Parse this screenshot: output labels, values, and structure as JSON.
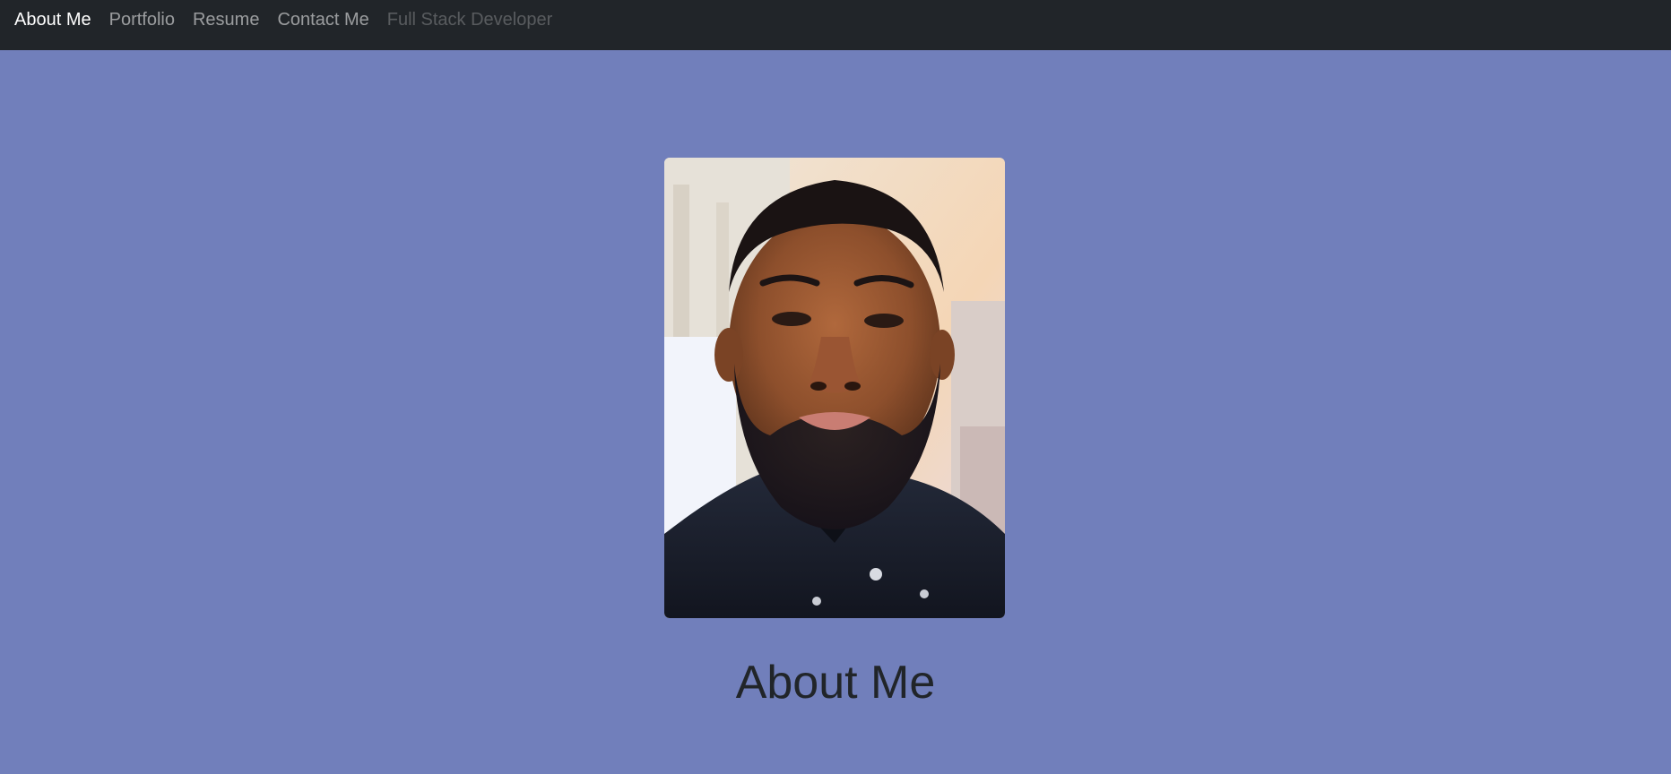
{
  "nav": {
    "about": "About Me",
    "portfolio": "Portfolio",
    "resume": "Resume",
    "contact": "Contact Me",
    "tagline": "Full Stack Developer"
  },
  "main": {
    "heading": "About Me"
  },
  "colors": {
    "navbar_bg": "#212529",
    "page_bg": "#717fbb",
    "heading_text": "#212529"
  }
}
